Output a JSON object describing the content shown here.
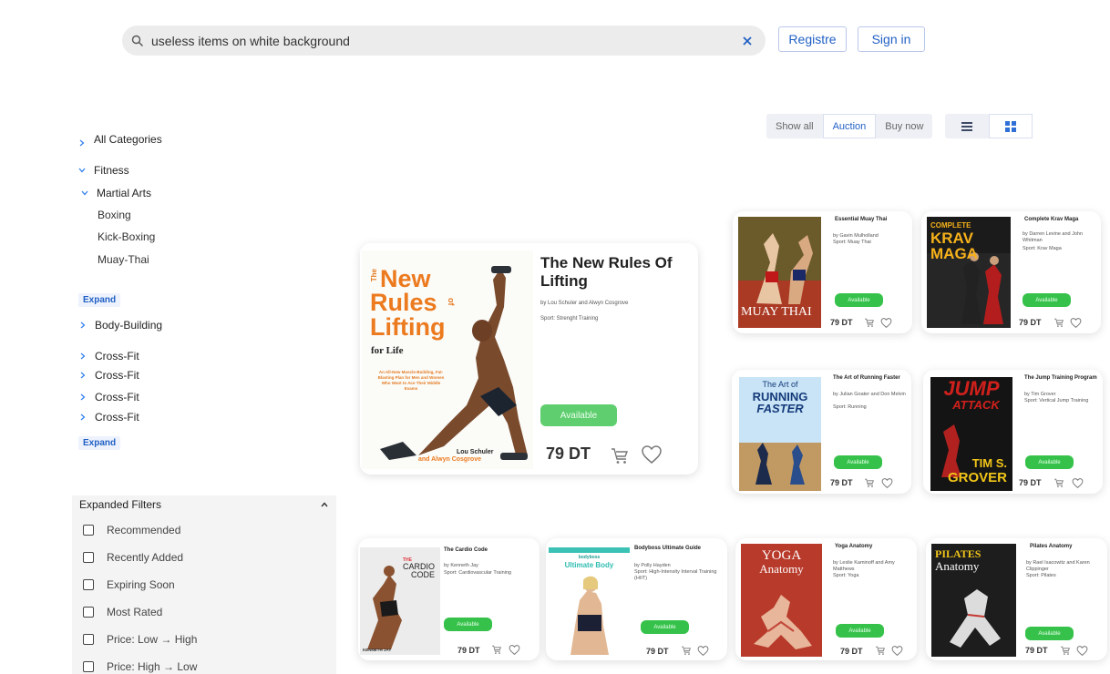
{
  "header": {
    "search_value": "useless items on white background",
    "register_label": "Registre",
    "signin_label": "Sign in"
  },
  "sidebar": {
    "all_categories": "All Categories",
    "fitness": "Fitness",
    "martial_arts": "Martial Arts",
    "martial_sub": [
      "Boxing",
      "Kick-Boxing",
      "Muay-Thai"
    ],
    "expand_label": "Expand",
    "body_building": "Body-Building",
    "crossfit_items": [
      "Cross-Fit",
      "Cross-Fit",
      "Cross-Fit",
      "Cross-Fit"
    ],
    "expand_label_2": "Expand"
  },
  "filters": {
    "title": "Expanded Filters",
    "options": [
      "Recommended",
      "Recently Added",
      "Expiring Soon",
      "Most Rated",
      "Price: Low → High",
      "Price: High → Low"
    ]
  },
  "view": {
    "segments": [
      "Show all",
      "Auction",
      "Buy now"
    ],
    "active_segment": "Auction",
    "layout_active": "grid"
  },
  "colors": {
    "accent": "#2160c4",
    "available": "#36c24a"
  },
  "products": [
    {
      "title": "The New Rules Of Lifting",
      "author": "by Lou Schuler and Alwyn Cosgrove",
      "sport": "Sport: Strenght Training",
      "status": "Available",
      "price": "79 DT",
      "cover": {
        "top": "The",
        "main": [
          "New",
          "Rules",
          "Lifting"
        ],
        "of": "of",
        "sub": "for Life",
        "tag": "An All-New Muscle-Building, Fat-Blasting Plan for Men and Women Who Want to Ace Their Middle Exams",
        "authors": [
          "Lou Schuler",
          "and Alwyn Cosgrove"
        ]
      }
    },
    {
      "title": "Essential Muay Thai",
      "author": "by Gavin Mulholland",
      "sport": "Sport: Muay Thai",
      "status": "Available",
      "price": "79 DT",
      "cover": {
        "main": "MUAY THAI"
      }
    },
    {
      "title": "Complete Krav Maga",
      "author": "by Darren Levine and John Whitman",
      "sport": "Sport: Krav Maga",
      "status": "Available",
      "price": "79 DT",
      "cover": {
        "top": "COMPLETE",
        "main": "KRAV MAGA"
      }
    },
    {
      "title": "The Art of Running Faster",
      "author": "by Julian Goater and Don Melvin",
      "sport": "Sport: Running",
      "status": "Available",
      "price": "79 DT",
      "cover": {
        "top": "The Art of",
        "main": [
          "RUNNING",
          "FASTER"
        ]
      }
    },
    {
      "title": "The Jump Training Program",
      "author": "by Tim Grover",
      "sport": "Sport: Vertical Jump Training",
      "status": "Available",
      "price": "79 DT",
      "cover": {
        "main": [
          "JUMP",
          "ATTACK"
        ],
        "author": [
          "TIM S.",
          "GROVER"
        ]
      }
    },
    {
      "title": "The Cardio Code",
      "author": "by Kenneth Jay",
      "sport": "Sport: Cardiovascular Training",
      "status": "Available",
      "price": "79 DT",
      "cover": {
        "main": [
          "CARDIO",
          "CODE"
        ],
        "pre": "THE",
        "author": "KENNETH JAY"
      }
    },
    {
      "title": "Bodyboss Ultimate Guide",
      "author": "by Polly Hayden",
      "sport": "Sport: High-Intensity Interval Training (HIIT)",
      "status": "Available",
      "price": "79 DT",
      "cover": {
        "top": "bodyboss",
        "main": "Ultimate Body"
      }
    },
    {
      "title": "Yoga Anatomy",
      "author": "by Leslie Kaminoff and Amy Matthews",
      "sport": "Sport: Yoga",
      "status": "Available",
      "price": "79 DT",
      "cover": {
        "main": [
          "YOGA",
          "Anatomy"
        ]
      }
    },
    {
      "title": "Pilates Anatomy",
      "author": "by Rael Isacowitz and Karen Clippinger",
      "sport": "Sport: Pilates",
      "status": "Available",
      "price": "79 DT",
      "cover": {
        "main": [
          "PILATES",
          "Anatomy"
        ]
      }
    }
  ]
}
